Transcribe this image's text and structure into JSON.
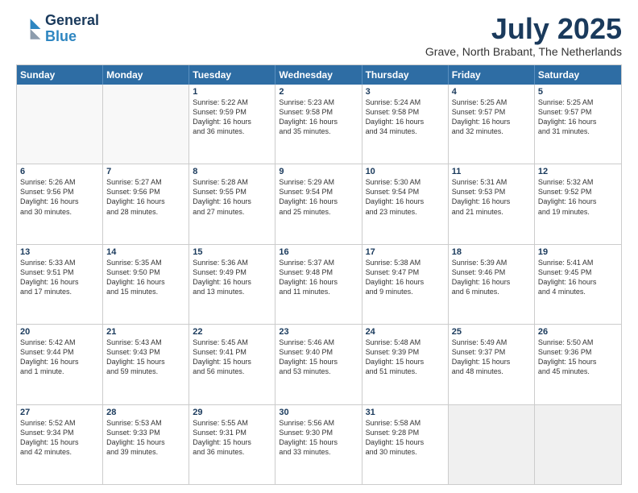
{
  "header": {
    "logo_line1": "General",
    "logo_line2": "Blue",
    "month": "July 2025",
    "location": "Grave, North Brabant, The Netherlands"
  },
  "weekdays": [
    "Sunday",
    "Monday",
    "Tuesday",
    "Wednesday",
    "Thursday",
    "Friday",
    "Saturday"
  ],
  "rows": [
    [
      {
        "day": "",
        "info": ""
      },
      {
        "day": "",
        "info": ""
      },
      {
        "day": "1",
        "info": "Sunrise: 5:22 AM\nSunset: 9:59 PM\nDaylight: 16 hours\nand 36 minutes."
      },
      {
        "day": "2",
        "info": "Sunrise: 5:23 AM\nSunset: 9:58 PM\nDaylight: 16 hours\nand 35 minutes."
      },
      {
        "day": "3",
        "info": "Sunrise: 5:24 AM\nSunset: 9:58 PM\nDaylight: 16 hours\nand 34 minutes."
      },
      {
        "day": "4",
        "info": "Sunrise: 5:25 AM\nSunset: 9:57 PM\nDaylight: 16 hours\nand 32 minutes."
      },
      {
        "day": "5",
        "info": "Sunrise: 5:25 AM\nSunset: 9:57 PM\nDaylight: 16 hours\nand 31 minutes."
      }
    ],
    [
      {
        "day": "6",
        "info": "Sunrise: 5:26 AM\nSunset: 9:56 PM\nDaylight: 16 hours\nand 30 minutes."
      },
      {
        "day": "7",
        "info": "Sunrise: 5:27 AM\nSunset: 9:56 PM\nDaylight: 16 hours\nand 28 minutes."
      },
      {
        "day": "8",
        "info": "Sunrise: 5:28 AM\nSunset: 9:55 PM\nDaylight: 16 hours\nand 27 minutes."
      },
      {
        "day": "9",
        "info": "Sunrise: 5:29 AM\nSunset: 9:54 PM\nDaylight: 16 hours\nand 25 minutes."
      },
      {
        "day": "10",
        "info": "Sunrise: 5:30 AM\nSunset: 9:54 PM\nDaylight: 16 hours\nand 23 minutes."
      },
      {
        "day": "11",
        "info": "Sunrise: 5:31 AM\nSunset: 9:53 PM\nDaylight: 16 hours\nand 21 minutes."
      },
      {
        "day": "12",
        "info": "Sunrise: 5:32 AM\nSunset: 9:52 PM\nDaylight: 16 hours\nand 19 minutes."
      }
    ],
    [
      {
        "day": "13",
        "info": "Sunrise: 5:33 AM\nSunset: 9:51 PM\nDaylight: 16 hours\nand 17 minutes."
      },
      {
        "day": "14",
        "info": "Sunrise: 5:35 AM\nSunset: 9:50 PM\nDaylight: 16 hours\nand 15 minutes."
      },
      {
        "day": "15",
        "info": "Sunrise: 5:36 AM\nSunset: 9:49 PM\nDaylight: 16 hours\nand 13 minutes."
      },
      {
        "day": "16",
        "info": "Sunrise: 5:37 AM\nSunset: 9:48 PM\nDaylight: 16 hours\nand 11 minutes."
      },
      {
        "day": "17",
        "info": "Sunrise: 5:38 AM\nSunset: 9:47 PM\nDaylight: 16 hours\nand 9 minutes."
      },
      {
        "day": "18",
        "info": "Sunrise: 5:39 AM\nSunset: 9:46 PM\nDaylight: 16 hours\nand 6 minutes."
      },
      {
        "day": "19",
        "info": "Sunrise: 5:41 AM\nSunset: 9:45 PM\nDaylight: 16 hours\nand 4 minutes."
      }
    ],
    [
      {
        "day": "20",
        "info": "Sunrise: 5:42 AM\nSunset: 9:44 PM\nDaylight: 16 hours\nand 1 minute."
      },
      {
        "day": "21",
        "info": "Sunrise: 5:43 AM\nSunset: 9:43 PM\nDaylight: 15 hours\nand 59 minutes."
      },
      {
        "day": "22",
        "info": "Sunrise: 5:45 AM\nSunset: 9:41 PM\nDaylight: 15 hours\nand 56 minutes."
      },
      {
        "day": "23",
        "info": "Sunrise: 5:46 AM\nSunset: 9:40 PM\nDaylight: 15 hours\nand 53 minutes."
      },
      {
        "day": "24",
        "info": "Sunrise: 5:48 AM\nSunset: 9:39 PM\nDaylight: 15 hours\nand 51 minutes."
      },
      {
        "day": "25",
        "info": "Sunrise: 5:49 AM\nSunset: 9:37 PM\nDaylight: 15 hours\nand 48 minutes."
      },
      {
        "day": "26",
        "info": "Sunrise: 5:50 AM\nSunset: 9:36 PM\nDaylight: 15 hours\nand 45 minutes."
      }
    ],
    [
      {
        "day": "27",
        "info": "Sunrise: 5:52 AM\nSunset: 9:34 PM\nDaylight: 15 hours\nand 42 minutes."
      },
      {
        "day": "28",
        "info": "Sunrise: 5:53 AM\nSunset: 9:33 PM\nDaylight: 15 hours\nand 39 minutes."
      },
      {
        "day": "29",
        "info": "Sunrise: 5:55 AM\nSunset: 9:31 PM\nDaylight: 15 hours\nand 36 minutes."
      },
      {
        "day": "30",
        "info": "Sunrise: 5:56 AM\nSunset: 9:30 PM\nDaylight: 15 hours\nand 33 minutes."
      },
      {
        "day": "31",
        "info": "Sunrise: 5:58 AM\nSunset: 9:28 PM\nDaylight: 15 hours\nand 30 minutes."
      },
      {
        "day": "",
        "info": ""
      },
      {
        "day": "",
        "info": ""
      }
    ]
  ]
}
